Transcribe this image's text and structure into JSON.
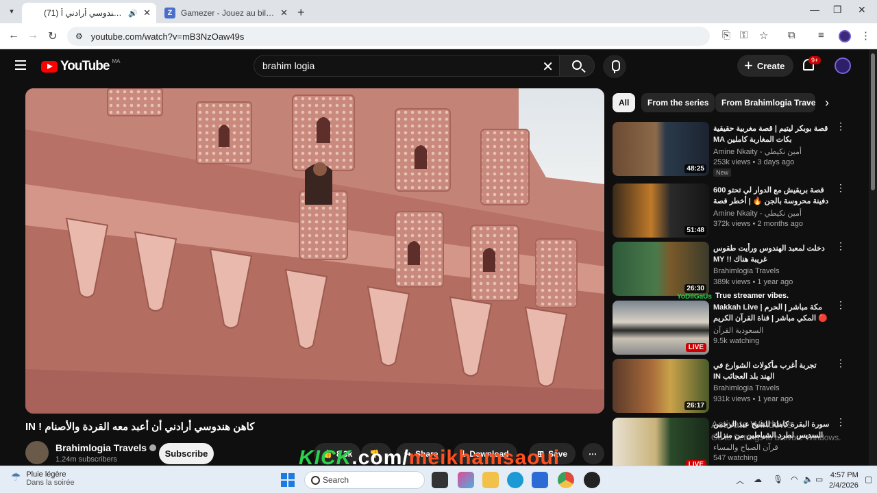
{
  "browser": {
    "tabs": [
      {
        "title": "(71) كاهن هندوسي أرادني أ",
        "active": true
      },
      {
        "title": "Gamezer - Jouez au billard, aux",
        "active": false
      }
    ],
    "url": "youtube.com/watch?v=mB3NzOaw49s"
  },
  "header": {
    "logo_text": "YouTube",
    "country_code": "MA",
    "search_value": "brahim logia",
    "create_label": "Create",
    "notifications_badge": "9+"
  },
  "video": {
    "title": "IN ! كاهن هندوسي أرادني أن أعبد معه القردة والأصنام",
    "channel": "Brahimlogia Travels",
    "subscribers": "1.24m subscribers",
    "subscribe_label": "Subscribe",
    "likes": "8.3k",
    "share_label": "Share",
    "download_label": "Download",
    "save_label": "Save",
    "overlay_kick": "KICK",
    "overlay_com": ".com/",
    "overlay_name": "meikhamsaoui"
  },
  "chips": [
    "All",
    "From the series",
    "From Brahimlogia Travels"
  ],
  "recommendations": [
    {
      "title": "قصة بوبكر ليتيم | قصة مغربية حقيقية بكات المغاربة كاملين MA",
      "channel": "Amine Nkaity - أمين نكيطي",
      "meta": "253k views • 3 days ago",
      "badge": "New",
      "duration": "48:25"
    },
    {
      "title": "قصة بريقيش مع الدوار لي تحتو 600 دفينة محروسة بالجن 🔥 | أخطر قصة وقعت في...",
      "channel": "Amine Nkaity - أمين نكيطي",
      "meta": "372k views • 2 months ago",
      "badge": "",
      "duration": "51:48"
    },
    {
      "title": "دخلت لمعبد الهندوس ورأيت طقوس غريبة هناك !! MY",
      "channel": "Brahimlogia Travels",
      "meta": "389k views • 1 year ago",
      "badge": "",
      "duration": "26:30"
    },
    {
      "title": "مكة مباشر | الحرم | Makkah Live 🔴 المكي مباشر | قناة القرآن الكريم السعودية ...",
      "channel": "السعودية القرآن",
      "meta": "9.5k watching",
      "badge": "",
      "duration": "LIVE"
    },
    {
      "title": "تجربة أغرب مأكولات الشوارع في الهند بلد العجائب IN",
      "channel": "Brahimlogia Travels",
      "meta": "931k views • 1 year ago",
      "badge": "",
      "duration": "26:17"
    },
    {
      "title": "سورة البقرة كاملة للشيخ عبد الرحمن السديس لطرد الشياطين من منزلك وجلب البركة بإذن",
      "channel": "قرآن الصباح والمساء",
      "meta": "547 watching",
      "badge": "",
      "duration": "LIVE"
    }
  ],
  "overlay_caption": "True streamer vibes.",
  "overlay_handle": "YoDIIGaUs",
  "windows_watermark": [
    "Activate Windows",
    "Go to Settings to activate Windows."
  ],
  "taskbar": {
    "weather_title": "Pluie légère",
    "weather_sub": "Dans la soirée",
    "search_label": "Search",
    "time": "4:57 PM",
    "date": "2/4/2026"
  }
}
